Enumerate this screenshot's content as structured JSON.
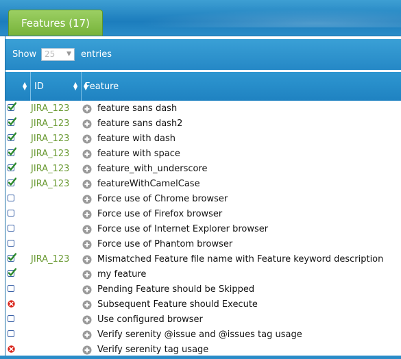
{
  "tab": {
    "label": "Features (17)"
  },
  "controls": {
    "show_label": "Show",
    "page_size": "25",
    "entries_label": "entries"
  },
  "table": {
    "headers": {
      "status": "",
      "id": "ID",
      "feature": "Feature"
    },
    "rows": [
      {
        "status": "passed",
        "id": "JIRA_123",
        "feature": "feature sans dash"
      },
      {
        "status": "passed",
        "id": "JIRA_123",
        "feature": "feature sans dash2"
      },
      {
        "status": "passed",
        "id": "JIRA_123",
        "feature": "feature with dash"
      },
      {
        "status": "passed",
        "id": "JIRA_123",
        "feature": "feature with space"
      },
      {
        "status": "passed",
        "id": "JIRA_123",
        "feature": "feature_with_underscore"
      },
      {
        "status": "passed",
        "id": "JIRA_123",
        "feature": "featureWithCamelCase"
      },
      {
        "status": "pending",
        "id": "",
        "feature": "Force use of Chrome browser"
      },
      {
        "status": "pending",
        "id": "",
        "feature": "Force use of Firefox browser"
      },
      {
        "status": "pending",
        "id": "",
        "feature": "Force use of Internet Explorer browser"
      },
      {
        "status": "pending",
        "id": "",
        "feature": "Force use of Phantom browser"
      },
      {
        "status": "passed",
        "id": "JIRA_123",
        "feature": "Mismatched Feature file name with Feature keyword description"
      },
      {
        "status": "passed",
        "id": "",
        "feature": "my feature"
      },
      {
        "status": "pending",
        "id": "",
        "feature": "Pending Feature should be Skipped"
      },
      {
        "status": "failed",
        "id": "",
        "feature": "Subsequent Feature should Execute"
      },
      {
        "status": "pending",
        "id": "",
        "feature": "Use configured browser"
      },
      {
        "status": "pending",
        "id": "",
        "feature": "Verify serenity @issue and @issues tag usage"
      },
      {
        "status": "failed",
        "id": "",
        "feature": "Verify serenity tag usage"
      }
    ]
  },
  "colors": {
    "header_blue": "#1f82c1",
    "tab_green": "#77b33a",
    "issue_green": "#6a9a33",
    "passed": "#2c8a2c",
    "failed": "#d9261c"
  },
  "icons": {
    "passed": "check-icon",
    "pending": "checkbox-icon",
    "failed": "error-icon",
    "expand": "plus-circle-icon",
    "sort": "sort-icon"
  }
}
